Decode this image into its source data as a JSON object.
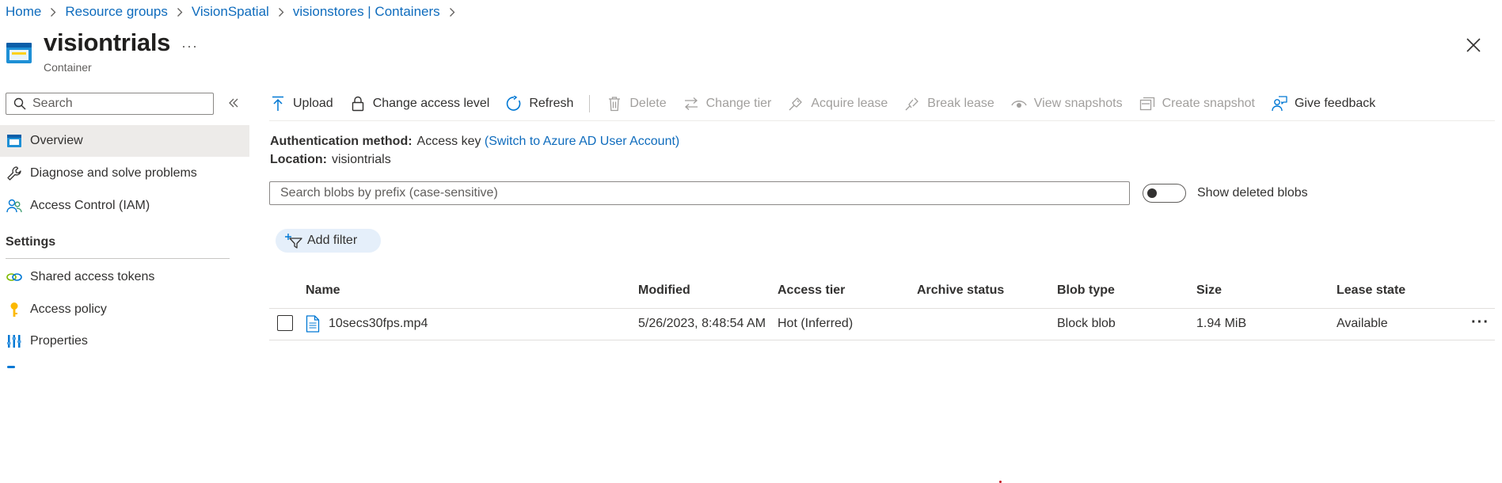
{
  "breadcrumb": {
    "items": [
      "Home",
      "Resource groups",
      "VisionSpatial",
      "visionstores | Containers"
    ]
  },
  "header": {
    "title": "visiontrials",
    "subtitle": "Container",
    "more": "···"
  },
  "sidebar": {
    "search_placeholder": "Search",
    "items": [
      {
        "label": "Overview",
        "icon": "container-icon",
        "active": true
      },
      {
        "label": "Diagnose and solve problems",
        "icon": "wrench-icon"
      },
      {
        "label": "Access Control (IAM)",
        "icon": "people-icon"
      }
    ],
    "settings_title": "Settings",
    "settings_items": [
      {
        "label": "Shared access tokens",
        "icon": "link-icon"
      },
      {
        "label": "Access policy",
        "icon": "key-icon"
      },
      {
        "label": "Properties",
        "icon": "properties-icon"
      }
    ]
  },
  "toolbar": {
    "upload": "Upload",
    "change_access_level": "Change access level",
    "refresh": "Refresh",
    "delete": "Delete",
    "change_tier": "Change tier",
    "acquire_lease": "Acquire lease",
    "break_lease": "Break lease",
    "view_snapshots": "View snapshots",
    "create_snapshot": "Create snapshot",
    "give_feedback": "Give feedback"
  },
  "info": {
    "auth_label": "Authentication method:",
    "auth_value": "Access key",
    "auth_link": "(Switch to Azure AD User Account)",
    "location_label": "Location:",
    "location_value": "visiontrials"
  },
  "blob_search": {
    "placeholder": "Search blobs by prefix (case-sensitive)"
  },
  "show_deleted": {
    "label": "Show deleted blobs",
    "enabled": false
  },
  "add_filter": "Add filter",
  "table": {
    "columns": [
      "Name",
      "Modified",
      "Access tier",
      "Archive status",
      "Blob type",
      "Size",
      "Lease state"
    ],
    "rows": [
      {
        "name": "10secs30fps.mp4",
        "modified": "5/26/2023, 8:48:54 AM",
        "access_tier": "Hot (Inferred)",
        "archive_status": "",
        "blob_type": "Block blob",
        "size": "1.94 MiB",
        "lease_state": "Available",
        "more": "···"
      }
    ]
  },
  "colors": {
    "accent": "#0f6cbd",
    "nav_active_bg": "#edebe9",
    "filter_pill_bg": "#e5effa",
    "disabled_text": "#a19f9d"
  }
}
